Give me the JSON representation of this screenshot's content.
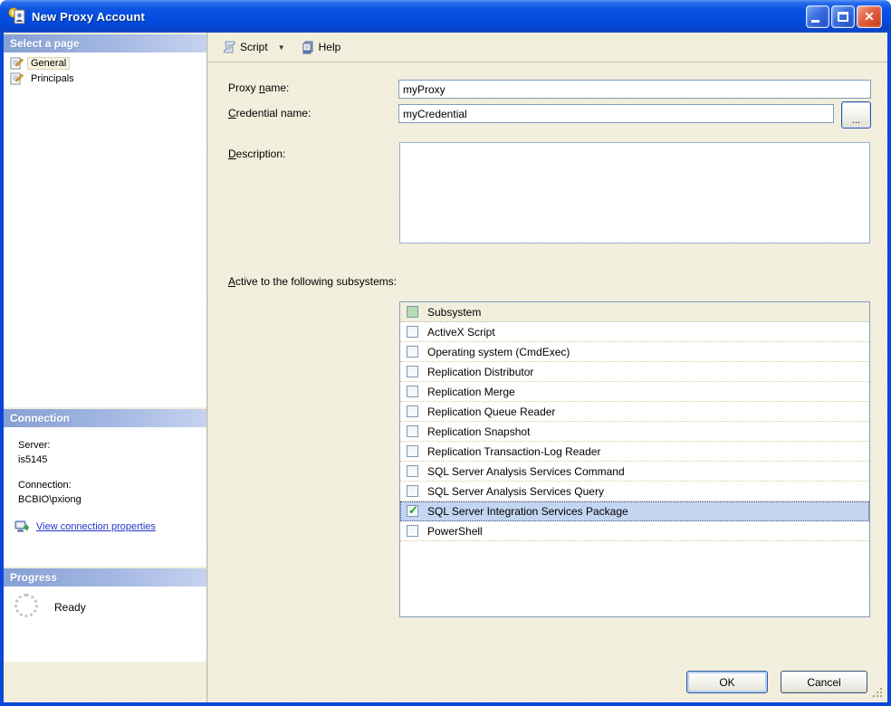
{
  "window": {
    "title": "New Proxy Account",
    "close_glyph": "✕"
  },
  "toolbar": {
    "script_label": "Script",
    "dropdown_glyph": "▼",
    "help_label": "Help"
  },
  "sidebar": {
    "select_page_header": "Select a page",
    "pages": [
      {
        "label": "General",
        "selected": true
      },
      {
        "label": "Principals",
        "selected": false
      }
    ],
    "connection_header": "Connection",
    "server_label": "Server:",
    "server_value": "is5145",
    "connection_label": "Connection:",
    "connection_value": "BCBIO\\pxiong",
    "view_connection_link": "View connection properties",
    "progress_header": "Progress",
    "progress_status": "Ready"
  },
  "form": {
    "proxy_name": {
      "label_pre": "Proxy ",
      "label_mn": "n",
      "label_post": "ame:",
      "value": "myProxy"
    },
    "credential_name": {
      "label_pre": "",
      "label_mn": "C",
      "label_post": "redential name:",
      "value": "myCredential",
      "browse_label": "..."
    },
    "description": {
      "label_pre": "",
      "label_mn": "D",
      "label_post": "escription:",
      "value": ""
    },
    "subsystems_label": {
      "label_pre": "",
      "label_mn": "A",
      "label_post": "ctive to the following subsystems:"
    }
  },
  "subsystems": {
    "header": "Subsystem",
    "rows": [
      {
        "label": "ActiveX Script",
        "checked": false,
        "selected": false
      },
      {
        "label": "Operating system (CmdExec)",
        "checked": false,
        "selected": false
      },
      {
        "label": "Replication Distributor",
        "checked": false,
        "selected": false
      },
      {
        "label": "Replication Merge",
        "checked": false,
        "selected": false
      },
      {
        "label": "Replication Queue Reader",
        "checked": false,
        "selected": false
      },
      {
        "label": "Replication Snapshot",
        "checked": false,
        "selected": false
      },
      {
        "label": "Replication Transaction-Log Reader",
        "checked": false,
        "selected": false
      },
      {
        "label": "SQL Server Analysis Services Command",
        "checked": false,
        "selected": false
      },
      {
        "label": "SQL Server Analysis Services Query",
        "checked": false,
        "selected": false
      },
      {
        "label": "SQL Server Integration Services Package",
        "checked": true,
        "selected": true
      },
      {
        "label": "PowerShell",
        "checked": false,
        "selected": false
      }
    ]
  },
  "footer": {
    "ok_label": "OK",
    "cancel_label": "Cancel"
  },
  "icons": {
    "check_glyph": "✓",
    "selection_color": "#c3d5f1",
    "titlebar_color": "#0349dc",
    "link_color": "#2236c9",
    "check_green": "#17a317"
  }
}
